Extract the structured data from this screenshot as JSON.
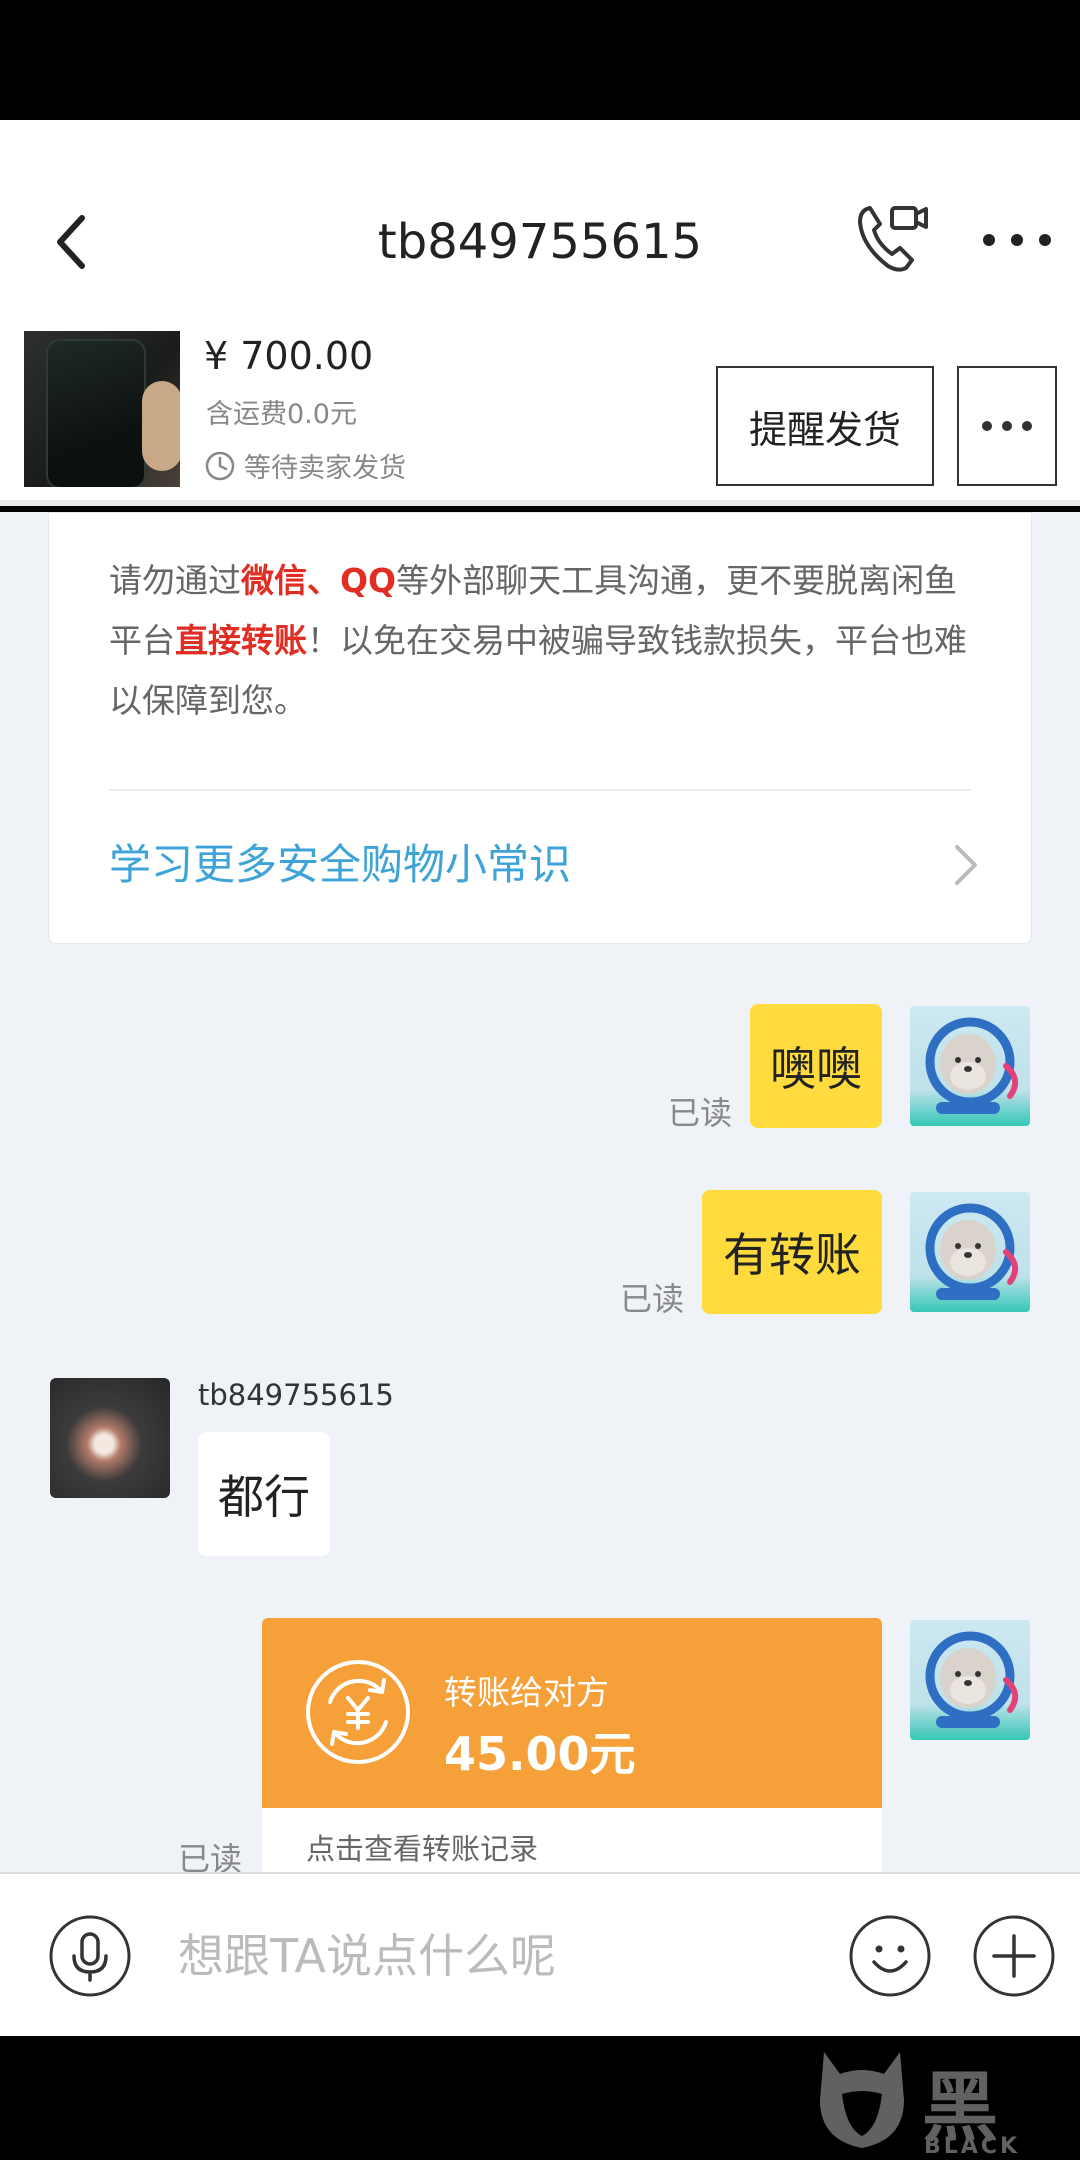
{
  "header": {
    "title": "tb849755615"
  },
  "order": {
    "price": "¥ 700.00",
    "shipping": "含运费0.0元",
    "status": "等待卖家发货",
    "remind_label": "提醒发货"
  },
  "warning": {
    "t1": "请勿通过",
    "t2": "微信、QQ",
    "t3": "等外部聊天工具沟通，更不要脱离闲鱼平台",
    "t4": "直接转账",
    "t5": "！以免在交易中被骗导致钱款损失，平台也难以保障到您。",
    "link": "学习更多安全购物小常识"
  },
  "messages": [
    {
      "text": "噢噢",
      "read": "已读"
    },
    {
      "text": "有转账",
      "read": "已读"
    },
    {
      "sender": "tb849755615",
      "text": "都行"
    }
  ],
  "transfer": {
    "title": "转账给对方",
    "amount": "45.00元",
    "footer": "点击查看转账记录",
    "read": "已读"
  },
  "input": {
    "placeholder": "想跟TA说点什么呢"
  },
  "watermark": {
    "cn": "黑猫",
    "en": "BLACK CAT"
  },
  "colors": {
    "my_bubble": "#ffdb3d",
    "transfer_card": "#f6a03a",
    "warning_red": "#e02e24",
    "link_blue": "#3ea3d8",
    "chat_background": "#eff2f6"
  },
  "icons": [
    "back-arrow-icon",
    "video-call-icon",
    "more-icon",
    "clock-icon",
    "chevron-right-icon",
    "transfer-yuan-icon",
    "microphone-icon",
    "emoji-icon",
    "plus-icon"
  ]
}
